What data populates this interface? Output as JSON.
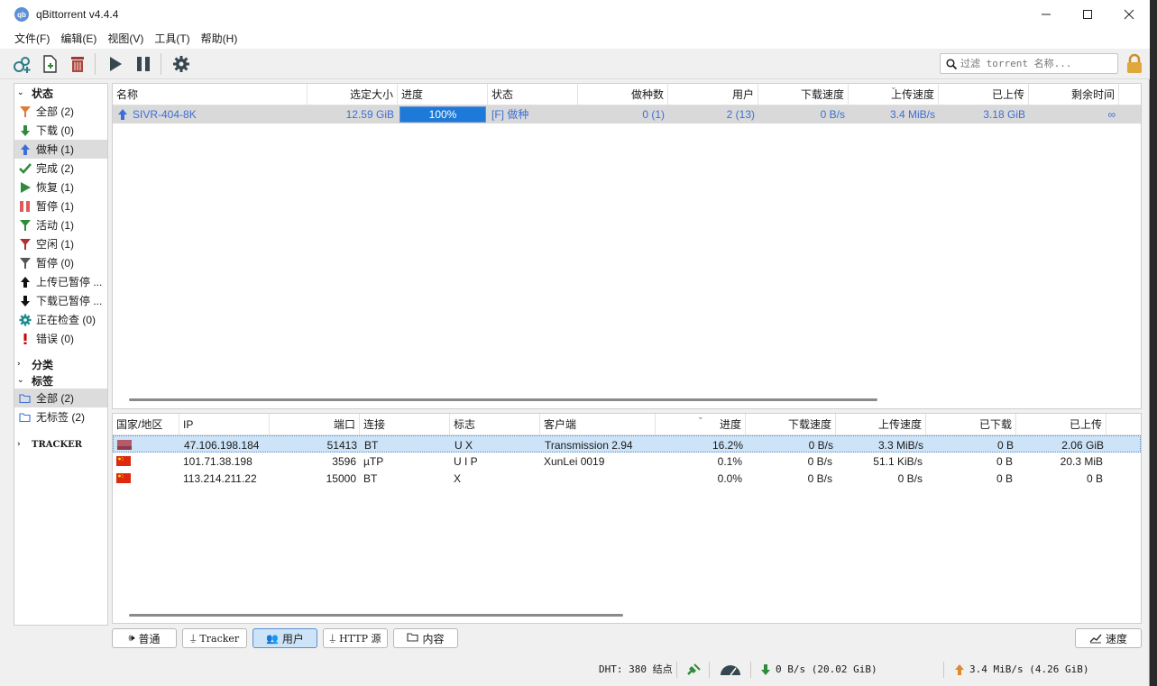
{
  "window": {
    "title": "qBittorrent v4.4.4",
    "app_icon": "qb"
  },
  "menu": [
    "文件(F)",
    "编辑(E)",
    "视图(V)",
    "工具(T)",
    "帮助(H)"
  ],
  "search": {
    "placeholder": "过滤 torrent 名称..."
  },
  "sidebar": {
    "status_title": "状态",
    "status_items": [
      {
        "label": "全部 (2)",
        "icon": "filter-icon",
        "color": "#e07b39"
      },
      {
        "label": "下载 (0)",
        "icon": "download-arrow-icon",
        "color": "#2e8b3a"
      },
      {
        "label": "做种 (1)",
        "icon": "upload-arrow-icon",
        "color": "#3c6fd6"
      },
      {
        "label": "完成 (2)",
        "icon": "checkmark-icon",
        "color": "#2e8b3a"
      },
      {
        "label": "恢复 (1)",
        "icon": "play-icon",
        "color": "#2e8b3a"
      },
      {
        "label": "暂停 (1)",
        "icon": "pause-icon",
        "color": "#e05a5a"
      },
      {
        "label": "活动 (1)",
        "icon": "filter-green-icon",
        "color": "#2e8b3a"
      },
      {
        "label": "空闲 (1)",
        "icon": "filter-red-icon",
        "color": "#b03030"
      },
      {
        "label": "暂停 (0)",
        "icon": "filter-gray-icon",
        "color": "#555555"
      },
      {
        "label": "上传已暂停 ...",
        "icon": "upload-black-icon",
        "color": "#111111"
      },
      {
        "label": "下载已暂停 ...",
        "icon": "download-black-icon",
        "color": "#111111"
      },
      {
        "label": "正在检查 (0)",
        "icon": "gear-teal-icon",
        "color": "#1b8a8a"
      },
      {
        "label": "错误 (0)",
        "icon": "error-icon",
        "color": "#d00000"
      }
    ],
    "category_title": "分类",
    "tags_title": "标签",
    "tag_items": [
      {
        "label": "全部 (2)",
        "icon": "folder-open-icon"
      },
      {
        "label": "无标签 (2)",
        "icon": "folder-open-icon"
      }
    ],
    "tracker_title": "TRACKER"
  },
  "torrent_table": {
    "columns": [
      "名称",
      "选定大小",
      "进度",
      "状态",
      "做种数",
      "用户",
      "下载速度",
      "上传速度",
      "已上传",
      "剩余时间"
    ],
    "rows": [
      {
        "name": "SIVR-404-8K",
        "size": "12.59 GiB",
        "progress_text": "100%",
        "progress": 1.0,
        "status": "[F] 做种",
        "seeds": "0 (1)",
        "peers": "2 (13)",
        "down_speed": "0 B/s",
        "up_speed": "3.4 MiB/s",
        "uploaded": "3.18 GiB",
        "eta": "∞"
      }
    ]
  },
  "peers_table": {
    "columns": [
      "国家/地区",
      "IP",
      "端口",
      "连接",
      "标志",
      "客户端",
      "进度",
      "下载速度",
      "上传速度",
      "已下载",
      "已上传"
    ],
    "rows": [
      {
        "flag": "unknown",
        "ip": "47.106.198.184",
        "port": "51413",
        "conn": "BT",
        "flags": "U X",
        "client": "Transmission 2.94",
        "progress": "16.2%",
        "down": "0 B/s",
        "up": "3.3 MiB/s",
        "downloaded": "0 B",
        "uploaded": "2.06 GiB"
      },
      {
        "flag": "cn",
        "ip": "101.71.38.198",
        "port": "3596",
        "conn": "µTP",
        "flags": "U I P",
        "client": "XunLei 0019",
        "progress": "0.1%",
        "down": "0 B/s",
        "up": "51.1 KiB/s",
        "downloaded": "0 B",
        "uploaded": "20.3 MiB"
      },
      {
        "flag": "cn",
        "ip": "113.214.211.22",
        "port": "15000",
        "conn": "BT",
        "flags": "X",
        "client": "",
        "progress": "0.0%",
        "down": "0 B/s",
        "up": "0 B/s",
        "downloaded": "0 B",
        "uploaded": "0 B"
      }
    ]
  },
  "tabs": [
    "普通",
    "Tracker",
    "用户",
    "HTTP 源",
    "内容"
  ],
  "active_tab": "用户",
  "speed_button": "速度",
  "statusbar": {
    "dht": "DHT: 380 结点",
    "download": "0 B/s (20.02 GiB)",
    "upload": "3.4 MiB/s (4.26 GiB)"
  },
  "colors": {
    "accent": "#1e7ad8",
    "selected_row": "#d9d9d9",
    "link_blue": "#3c6fd6"
  }
}
